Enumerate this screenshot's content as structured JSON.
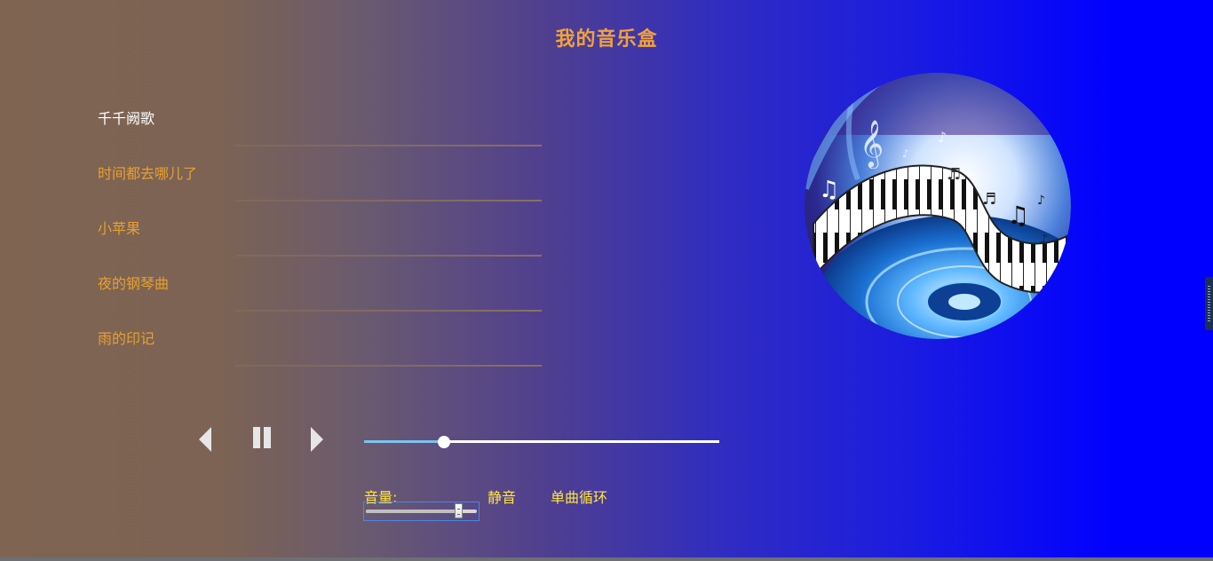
{
  "app": {
    "title": "我的音乐盒"
  },
  "playlist": {
    "songs": [
      {
        "title": "千千阙歌"
      },
      {
        "title": "时间都去哪儿了"
      },
      {
        "title": "小苹果"
      },
      {
        "title": "夜的钢琴曲"
      },
      {
        "title": "雨的印记"
      }
    ],
    "active_index": 0
  },
  "album_art": {
    "icon": "piano-music-art"
  },
  "controls": {
    "prev_icon": "triangle-left-icon",
    "pause_icon": "pause-icon",
    "next_icon": "triangle-right-icon",
    "progress_fraction": 0.225
  },
  "volume": {
    "label": "音量:",
    "level_fraction": 0.83,
    "mute_label": "静音",
    "loop_label": "单曲循环"
  },
  "colors": {
    "title": "#f2a23a",
    "song_inactive": "#e8a032",
    "song_active": "#ffffff",
    "controls_text": "#ffe640",
    "progress_played": "#7cc4ee",
    "progress_track": "#ffffff",
    "background_left": "#7f6452",
    "background_right": "#0000ff"
  }
}
